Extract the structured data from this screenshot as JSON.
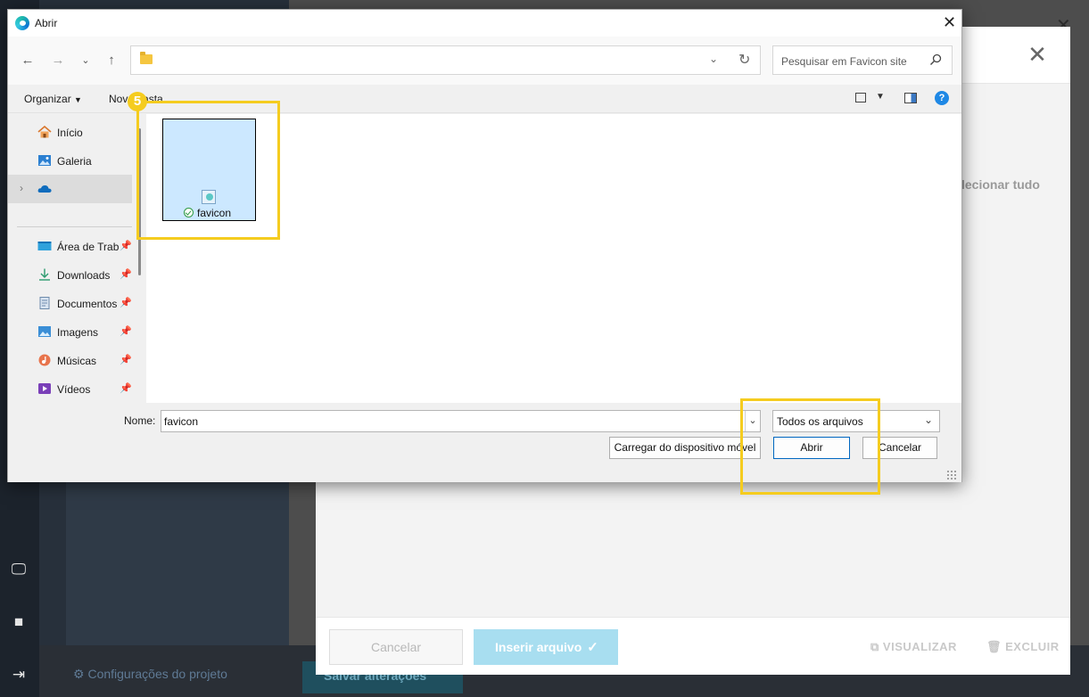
{
  "background_app": {
    "project_config_label": "Configurações do projeto",
    "save_changes_label": "Salvar alterações",
    "modal": {
      "select_all_label": "lecionar tudo",
      "cancel_label": "Cancelar",
      "insert_file_label": "Inserir arquivo",
      "preview_label": "VISUALIZAR",
      "delete_label": "EXCLUIR"
    }
  },
  "dialog": {
    "title": "Abrir",
    "search_placeholder": "Pesquisar em Favicon site",
    "toolbar": {
      "organize_label": "Organizar",
      "new_folder_label": "Nova pasta"
    },
    "sidebar": {
      "items": [
        {
          "label": "Início",
          "icon": "home-icon"
        },
        {
          "label": "Galeria",
          "icon": "gallery-icon"
        },
        {
          "label": "",
          "icon": "onedrive-cloud-icon"
        },
        {
          "label": "Área de Trabalho",
          "icon": "desktop-icon",
          "pinned": true
        },
        {
          "label": "Downloads",
          "icon": "download-icon",
          "pinned": true
        },
        {
          "label": "Documentos",
          "icon": "documents-icon",
          "pinned": true
        },
        {
          "label": "Imagens",
          "icon": "pictures-icon",
          "pinned": true
        },
        {
          "label": "Músicas",
          "icon": "music-icon",
          "pinned": true
        },
        {
          "label": "Vídeos",
          "icon": "videos-icon",
          "pinned": true
        }
      ]
    },
    "files": [
      {
        "name": "favicon",
        "selected": true,
        "sync_status": "synced"
      }
    ],
    "bottom": {
      "name_label": "Nome:",
      "name_value": "favicon",
      "file_type_value": "Todos os arquivos",
      "upload_label": "Carregar do dispositivo móvel",
      "open_label": "Abrir",
      "cancel_label": "Cancelar"
    }
  },
  "annotation": {
    "step_number": "5",
    "highlight_color": "#f5cc1f"
  },
  "colors": {
    "accent": "#0067c0",
    "selection": "#cce8ff",
    "insert_button": "#a8def0"
  }
}
